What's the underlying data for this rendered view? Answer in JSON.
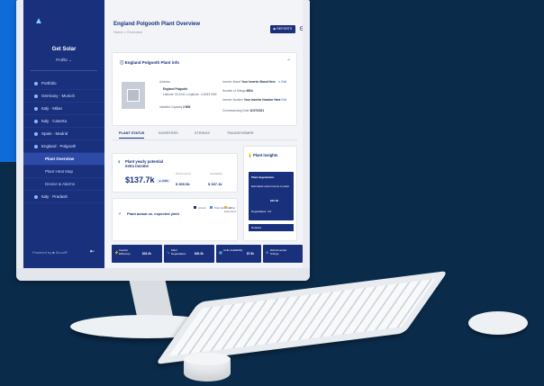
{
  "app": {
    "org_name": "Get Solar",
    "profile_label": "Profile ⌄",
    "page_title": "England Polgooth Plant Overview",
    "breadcrumb": "Home > Overview",
    "primary_button": "▶ REPORTS",
    "powered_by": "Powered by ■ Scout®",
    "colors": {
      "brand": "#19307d",
      "accent": "#0e6bd8",
      "background": "#0b2b4a"
    }
  },
  "sidebar": {
    "items": [
      {
        "label": "Portfolio",
        "indent": false,
        "active": false
      },
      {
        "label": "Germany · Munich",
        "indent": false,
        "active": false
      },
      {
        "label": "Italy · Milan",
        "indent": false,
        "active": false
      },
      {
        "label": "Italy · Caserta",
        "indent": false,
        "active": false
      },
      {
        "label": "Spain · Madrid",
        "indent": false,
        "active": false
      },
      {
        "label": "England · Polgooth",
        "indent": false,
        "active": false
      },
      {
        "label": "Plant Overview",
        "indent": true,
        "active": true
      },
      {
        "label": "Plant Heat Map",
        "indent": true,
        "active": false
      },
      {
        "label": "Device & Alarms",
        "indent": true,
        "active": false
      },
      {
        "label": "Italy · Pradash",
        "indent": false,
        "active": false
      }
    ]
  },
  "info": {
    "title": "England Polgooth Plant info",
    "fields": [
      {
        "label": "Address",
        "value": ""
      },
      {
        "label": "",
        "value": "England Polgooth"
      },
      {
        "label": "",
        "value": "Latitude: 50.3441 Longitude: -4.8183 GBK"
      },
      {
        "label": "Installed Capacity",
        "value": "2 MW"
      },
      {
        "label": "Inverter Brand",
        "value": "Your Inverter Brand Here"
      },
      {
        "label": "Number of Strings",
        "value": "6504"
      },
      {
        "label": "Inverter Number",
        "value": "Your Inverter Number Here"
      },
      {
        "label": "Commissioning Date",
        "value": "11/07/2021"
      }
    ],
    "edit_label": "✎ Edit"
  },
  "tabs": [
    "PLANT STATUS",
    "INVERTERS",
    "STRINGS",
    "TRANSFORMER"
  ],
  "potential": {
    "label": "Plant yearly potential extra income",
    "value": "$137.7k",
    "badge": "▲ 4.0%",
    "mini_1_label": "Performance",
    "mini_1_value": "$ 300.5k",
    "mini_2_label": "Availability",
    "mini_2_value": "$ 337.1k"
  },
  "actual": {
    "title": "Plant actual vs. expected yield",
    "legend": [
      "Actual",
      "Past Expected",
      "Other Expected"
    ]
  },
  "insights": {
    "title": "Plant insights",
    "box_title": "Plant degradation",
    "box_lines": [
      "Estimated extra income to plant",
      "$40.5k",
      "Degradation: 4.6"
    ],
    "button": "Detailed"
  },
  "kpis": [
    {
      "label": "Inverter Efficiency",
      "value": "$23.2k"
    },
    {
      "label": "Plant Degradation",
      "value": "$40.3k"
    },
    {
      "label": "Cells Availability",
      "value": "$7.5k"
    },
    {
      "label": "Disconnected Strings",
      "value": ""
    }
  ]
}
